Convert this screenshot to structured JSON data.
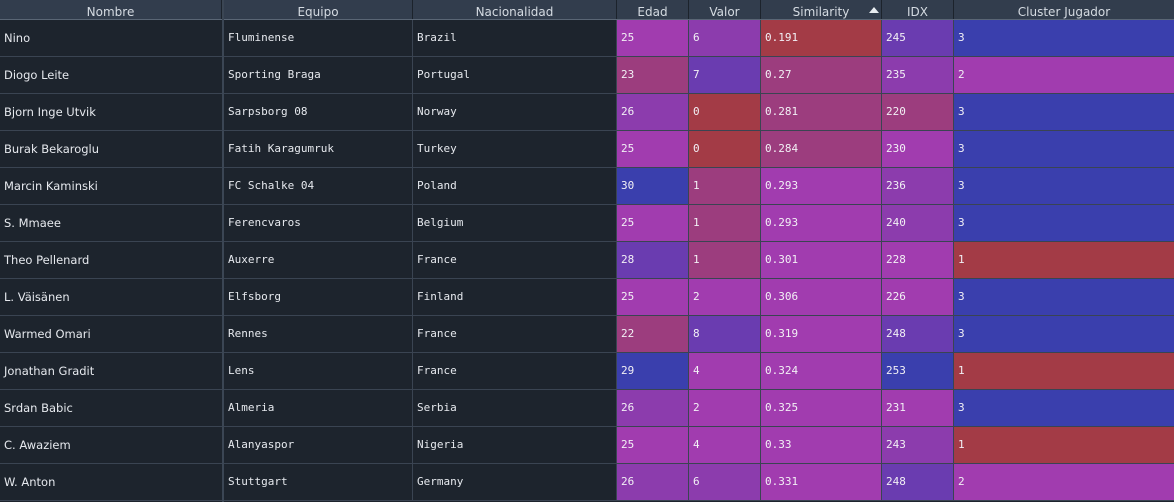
{
  "colors": {
    "blue": "#3a3fad",
    "violet": "#6a3cb0",
    "purple": "#8c3cad",
    "magenta": "#a13caf",
    "rose": "#9c3d7e",
    "red": "#a33b46"
  },
  "headers": {
    "nombre": "Nombre",
    "equipo": "Equipo",
    "nacionalidad": "Nacionalidad",
    "edad": "Edad",
    "valor": "Valor",
    "similarity": "Similarity",
    "idx": "IDX",
    "cluster": "Cluster Jugador"
  },
  "sort": {
    "column": "similarity",
    "direction": "ascending"
  },
  "rows": [
    {
      "nombre": "Nino",
      "equipo": "Fluminense",
      "nacionalidad": "Brazil",
      "edad": "25",
      "valor": "6",
      "similarity": "0.191",
      "idx": "245",
      "cluster": "3",
      "heat": {
        "edad": "magenta",
        "valor": "purple",
        "similarity": "red",
        "idx": "violet",
        "cluster": "blue"
      }
    },
    {
      "nombre": "Diogo Leite",
      "equipo": "Sporting Braga",
      "nacionalidad": "Portugal",
      "edad": "23",
      "valor": "7",
      "similarity": "0.27",
      "idx": "235",
      "cluster": "2",
      "heat": {
        "edad": "rose",
        "valor": "violet",
        "similarity": "rose",
        "idx": "purple",
        "cluster": "magenta"
      }
    },
    {
      "nombre": "Bjorn Inge Utvik",
      "equipo": "Sarpsborg 08",
      "nacionalidad": "Norway",
      "edad": "26",
      "valor": "0",
      "similarity": "0.281",
      "idx": "220",
      "cluster": "3",
      "heat": {
        "edad": "purple",
        "valor": "red",
        "similarity": "rose",
        "idx": "rose",
        "cluster": "blue"
      }
    },
    {
      "nombre": "Burak Bekaroglu",
      "equipo": "Fatih Karagumruk",
      "nacionalidad": "Turkey",
      "edad": "25",
      "valor": "0",
      "similarity": "0.284",
      "idx": "230",
      "cluster": "3",
      "heat": {
        "edad": "magenta",
        "valor": "red",
        "similarity": "rose",
        "idx": "magenta",
        "cluster": "blue"
      }
    },
    {
      "nombre": "Marcin Kaminski",
      "equipo": "FC Schalke 04",
      "nacionalidad": "Poland",
      "edad": "30",
      "valor": "1",
      "similarity": "0.293",
      "idx": "236",
      "cluster": "3",
      "heat": {
        "edad": "blue",
        "valor": "rose",
        "similarity": "magenta",
        "idx": "purple",
        "cluster": "blue"
      }
    },
    {
      "nombre": "S. Mmaee",
      "equipo": "Ferencvaros",
      "nacionalidad": "Belgium",
      "edad": "25",
      "valor": "1",
      "similarity": "0.293",
      "idx": "240",
      "cluster": "3",
      "heat": {
        "edad": "magenta",
        "valor": "rose",
        "similarity": "magenta",
        "idx": "purple",
        "cluster": "blue"
      }
    },
    {
      "nombre": "Theo Pellenard",
      "equipo": "Auxerre",
      "nacionalidad": "France",
      "edad": "28",
      "valor": "1",
      "similarity": "0.301",
      "idx": "228",
      "cluster": "1",
      "heat": {
        "edad": "violet",
        "valor": "rose",
        "similarity": "magenta",
        "idx": "magenta",
        "cluster": "red"
      }
    },
    {
      "nombre": "L. Väisänen",
      "equipo": "Elfsborg",
      "nacionalidad": "Finland",
      "edad": "25",
      "valor": "2",
      "similarity": "0.306",
      "idx": "226",
      "cluster": "3",
      "heat": {
        "edad": "magenta",
        "valor": "magenta",
        "similarity": "magenta",
        "idx": "magenta",
        "cluster": "blue"
      }
    },
    {
      "nombre": "Warmed Omari",
      "equipo": "Rennes",
      "nacionalidad": "France",
      "edad": "22",
      "valor": "8",
      "similarity": "0.319",
      "idx": "248",
      "cluster": "3",
      "heat": {
        "edad": "rose",
        "valor": "violet",
        "similarity": "magenta",
        "idx": "violet",
        "cluster": "blue"
      }
    },
    {
      "nombre": "Jonathan Gradit",
      "equipo": "Lens",
      "nacionalidad": "France",
      "edad": "29",
      "valor": "4",
      "similarity": "0.324",
      "idx": "253",
      "cluster": "1",
      "heat": {
        "edad": "blue",
        "valor": "magenta",
        "similarity": "magenta",
        "idx": "blue",
        "cluster": "red"
      }
    },
    {
      "nombre": "Srdan Babic",
      "equipo": "Almeria",
      "nacionalidad": "Serbia",
      "edad": "26",
      "valor": "2",
      "similarity": "0.325",
      "idx": "231",
      "cluster": "3",
      "heat": {
        "edad": "purple",
        "valor": "magenta",
        "similarity": "magenta",
        "idx": "magenta",
        "cluster": "blue"
      }
    },
    {
      "nombre": "C. Awaziem",
      "equipo": "Alanyaspor",
      "nacionalidad": "Nigeria",
      "edad": "25",
      "valor": "4",
      "similarity": "0.33",
      "idx": "243",
      "cluster": "1",
      "heat": {
        "edad": "magenta",
        "valor": "magenta",
        "similarity": "magenta",
        "idx": "purple",
        "cluster": "red"
      }
    },
    {
      "nombre": "W. Anton",
      "equipo": "Stuttgart",
      "nacionalidad": "Germany",
      "edad": "26",
      "valor": "6",
      "similarity": "0.331",
      "idx": "248",
      "cluster": "2",
      "heat": {
        "edad": "purple",
        "valor": "purple",
        "similarity": "magenta",
        "idx": "violet",
        "cluster": "magenta"
      }
    }
  ]
}
